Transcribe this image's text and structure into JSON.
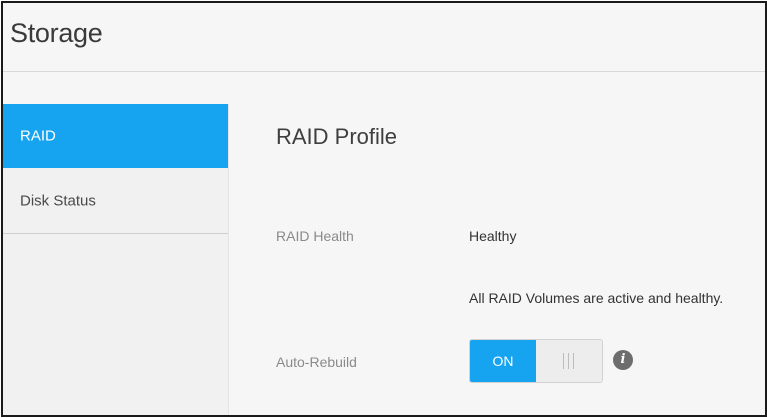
{
  "header": {
    "title": "Storage"
  },
  "sidebar": {
    "items": [
      {
        "label": "RAID",
        "active": true
      },
      {
        "label": "Disk Status",
        "active": false
      }
    ]
  },
  "main": {
    "section_title": "RAID Profile",
    "raid_health": {
      "label": "RAID Health",
      "value": "Healthy",
      "detail": "All RAID Volumes are active and healthy."
    },
    "auto_rebuild": {
      "label": "Auto-Rebuild",
      "toggle_label": "ON",
      "state": "on"
    }
  },
  "icons": {
    "info": "info-icon",
    "info_glyph": "i"
  },
  "colors": {
    "accent": "#16a3f0",
    "background": "#f6f6f6",
    "sidebar_bg": "#f1f1f1",
    "icon_gray": "#6d6d6d"
  }
}
